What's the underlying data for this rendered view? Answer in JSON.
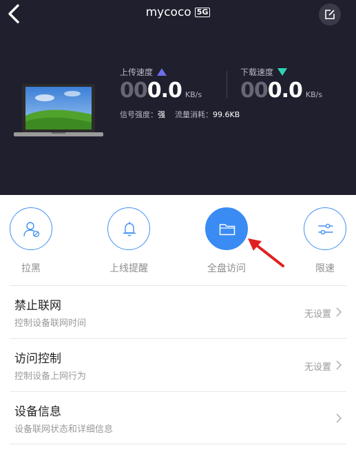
{
  "header": {
    "title": "mycoco",
    "badge": "5G"
  },
  "upload": {
    "label": "上传速度",
    "speed_dim": "00",
    "speed_value": "0.0",
    "unit": "KB/s"
  },
  "download": {
    "label": "下载速度",
    "speed_dim": "00",
    "speed_value": "0.0",
    "unit": "KB/s"
  },
  "stats": {
    "signal_label": "信号强度：",
    "signal_value": "强",
    "traffic_label": "流量消耗：",
    "traffic_value": "99.6KB"
  },
  "actions": [
    {
      "label": "拉黑",
      "icon": "user-block-icon"
    },
    {
      "label": "上线提醒",
      "icon": "bell-icon"
    },
    {
      "label": "全盘访问",
      "icon": "folder-icon"
    },
    {
      "label": "限速",
      "icon": "sliders-icon"
    }
  ],
  "list": [
    {
      "title": "禁止联网",
      "subtitle": "控制设备联网时间",
      "value": "无设置"
    },
    {
      "title": "访问控制",
      "subtitle": "控制设备上网行为",
      "value": "无设置"
    },
    {
      "title": "设备信息",
      "subtitle": "设备联网状态和详细信息",
      "value": ""
    }
  ],
  "colors": {
    "header_bg": "#1f1f2d",
    "accent": "#3a8bf3",
    "upload_arrow": "#6b6fe8",
    "download_arrow": "#2fd3b6",
    "annotation_arrow": "#e02020"
  }
}
